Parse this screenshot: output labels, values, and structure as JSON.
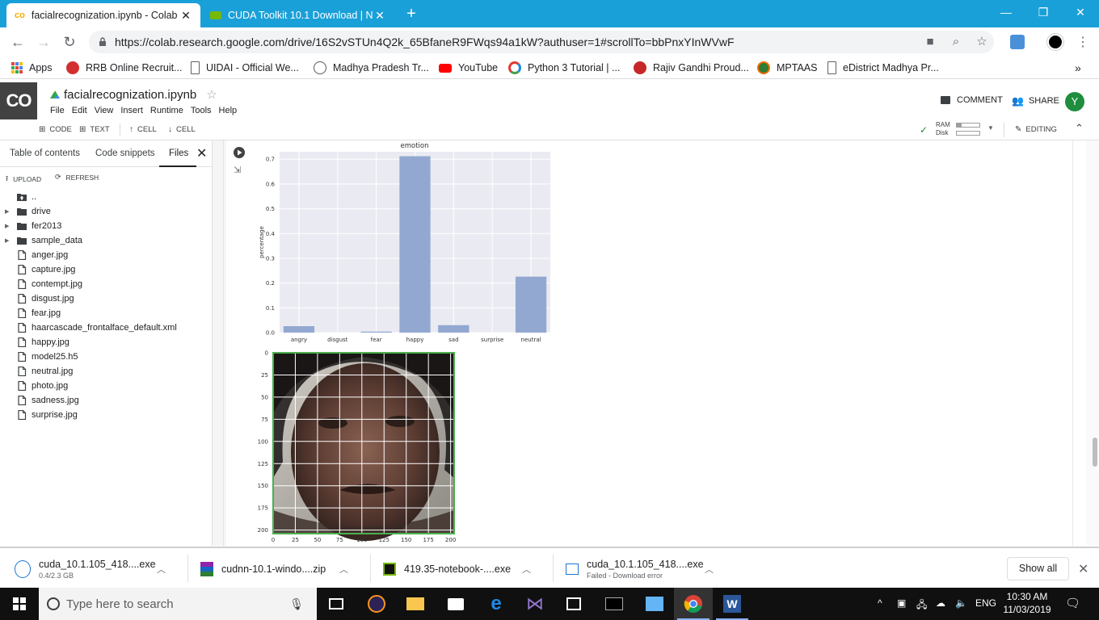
{
  "browser": {
    "tabs": [
      {
        "title": "facialrecognization.ipynb - Colab",
        "active": true,
        "icon": "colab-icon"
      },
      {
        "title": "CUDA Toolkit 10.1 Download | NV",
        "active": false,
        "icon": "nvidia-icon"
      }
    ],
    "url": "https://colab.research.google.com/drive/16S2vSTUn4Q2k_65BfaneR9FWqs94a1kW?authuser=1#scrollTo=bbPnxYInWVwF",
    "bookmarks": [
      {
        "label": "Apps",
        "icon": "apps-grid-icon"
      },
      {
        "label": "RRB Online Recruit...",
        "icon": "rrb-icon"
      },
      {
        "label": "UIDAI - Official We...",
        "icon": "page-icon"
      },
      {
        "label": "Madhya Pradesh Tr...",
        "icon": "mp-icon"
      },
      {
        "label": "YouTube",
        "icon": "youtube-icon"
      },
      {
        "label": "Python 3 Tutorial | ...",
        "icon": "python-icon"
      },
      {
        "label": "Rajiv Gandhi Proud...",
        "icon": "rgpv-icon"
      },
      {
        "label": "MPTAAS",
        "icon": "mptaas-icon"
      },
      {
        "label": "eDistrict Madhya Pr...",
        "icon": "page-icon"
      }
    ],
    "bookmarks_more": "»"
  },
  "colab": {
    "logo": "CO",
    "notebook_title": "facialrecognization.ipynb",
    "menu": [
      "File",
      "Edit",
      "View",
      "Insert",
      "Runtime",
      "Tools",
      "Help"
    ],
    "comment_label": "COMMENT",
    "share_label": "SHARE",
    "avatar_letter": "Y",
    "toolbar": {
      "code_label": "CODE",
      "text_label": "TEXT",
      "cell_up_label": "CELL",
      "cell_down_label": "CELL",
      "ram_label": "RAM",
      "disk_label": "Disk",
      "editing_label": "EDITING"
    }
  },
  "side_panel": {
    "tabs": [
      "Table of contents",
      "Code snippets",
      "Files"
    ],
    "active_tab": "Files",
    "upload_label": "UPLOAD",
    "refresh_label": "REFRESH",
    "files": [
      {
        "name": "..",
        "type": "up"
      },
      {
        "name": "drive",
        "type": "folder"
      },
      {
        "name": "fer2013",
        "type": "folder"
      },
      {
        "name": "sample_data",
        "type": "folder"
      },
      {
        "name": "anger.jpg",
        "type": "file"
      },
      {
        "name": "capture.jpg",
        "type": "file"
      },
      {
        "name": "contempt.jpg",
        "type": "file"
      },
      {
        "name": "disgust.jpg",
        "type": "file"
      },
      {
        "name": "fear.jpg",
        "type": "file"
      },
      {
        "name": "haarcascade_frontalface_default.xml",
        "type": "file"
      },
      {
        "name": "happy.jpg",
        "type": "file"
      },
      {
        "name": "model25.h5",
        "type": "file"
      },
      {
        "name": "neutral.jpg",
        "type": "file"
      },
      {
        "name": "photo.jpg",
        "type": "file"
      },
      {
        "name": "sadness.jpg",
        "type": "file"
      },
      {
        "name": "surprise.jpg",
        "type": "file"
      }
    ]
  },
  "chart_data": [
    {
      "type": "bar",
      "title": "emotion",
      "ylabel": "percentage",
      "xlabel": "",
      "categories": [
        "angry",
        "disgust",
        "fear",
        "happy",
        "sad",
        "surprise",
        "neutral"
      ],
      "values": [
        0.026,
        0.0,
        0.004,
        0.712,
        0.03,
        0.0,
        0.226
      ],
      "ylim": [
        0,
        0.73
      ],
      "yticks": [
        "0.0",
        "0.1",
        "0.2",
        "0.3",
        "0.4",
        "0.5",
        "0.6",
        "0.7"
      ],
      "ytick_values": [
        0,
        0.1,
        0.2,
        0.3,
        0.4,
        0.5,
        0.6,
        0.7
      ],
      "bar_color": "#92a8d1",
      "background": "#eaeaf2",
      "grid": true
    },
    {
      "type": "image",
      "xticks": [
        "0",
        "25",
        "50",
        "75",
        "100",
        "125",
        "150",
        "175",
        "200"
      ],
      "yticks": [
        "0",
        "25",
        "50",
        "75",
        "100",
        "125",
        "150",
        "175",
        "200"
      ],
      "tick_values": [
        0,
        25,
        50,
        75,
        100,
        125,
        150,
        175,
        200
      ],
      "range": [
        0,
        204
      ],
      "grid": true,
      "frame_color": "#4caf50"
    }
  ],
  "downloads": [
    {
      "name": "cuda_10.1.105_418....exe",
      "sub": "0.4/2.3 GB",
      "icon": "installer-icon"
    },
    {
      "name": "cudnn-10.1-windo....zip",
      "sub": "",
      "icon": "winrar-icon"
    },
    {
      "name": "419.35-notebook-....exe",
      "sub": "",
      "icon": "nvidia-icon"
    },
    {
      "name": "cuda_10.1.105_418....exe",
      "sub": "Failed - Download error",
      "icon": "installer-icon"
    }
  ],
  "show_all_label": "Show all",
  "taskbar": {
    "search_placeholder": "Type here to search",
    "language": "ENG",
    "time": "10:30 AM",
    "date": "11/03/2019"
  }
}
